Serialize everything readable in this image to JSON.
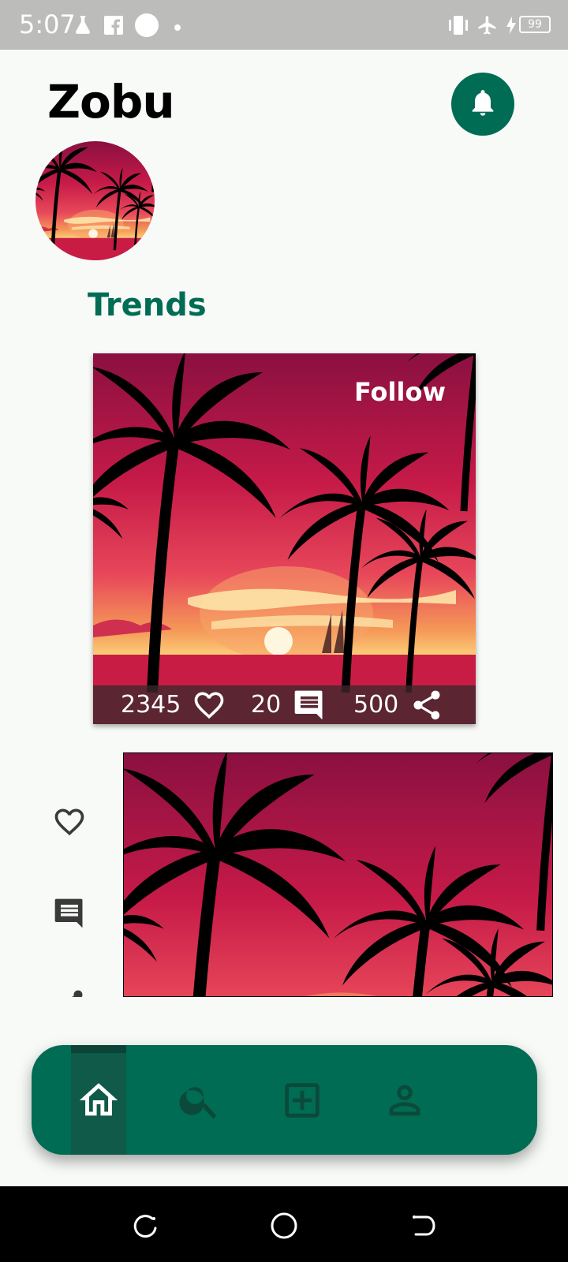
{
  "status_bar": {
    "time": "5:07",
    "battery": "99",
    "icons": [
      "flask-icon",
      "facebook-icon",
      "circle-icon",
      "dot-icon",
      "vibrate-icon",
      "airplane-icon",
      "charging-icon",
      "battery-icon"
    ]
  },
  "header": {
    "title": "Zobu",
    "notification_icon": "bell-icon"
  },
  "section": {
    "title": "Trends"
  },
  "trend_card": {
    "follow_label": "Follow",
    "likes": "2345",
    "comments": "20",
    "shares": "500"
  },
  "second_post": {
    "side_actions": [
      "heart-icon",
      "comment-icon",
      "share-icon"
    ]
  },
  "bottom_nav": {
    "items": [
      {
        "icon": "home-icon",
        "active": true
      },
      {
        "icon": "search-icon",
        "active": false
      },
      {
        "icon": "add-box-icon",
        "active": false
      },
      {
        "icon": "person-icon",
        "active": false
      }
    ]
  },
  "system_nav": [
    "recent-apps-icon",
    "home-circle-icon",
    "back-icon"
  ],
  "colors": {
    "accent": "#006c54",
    "status_bar": "#bcbdbb",
    "background": "#f8faf8",
    "nav_icon_inactive": "#0b4a3b"
  }
}
